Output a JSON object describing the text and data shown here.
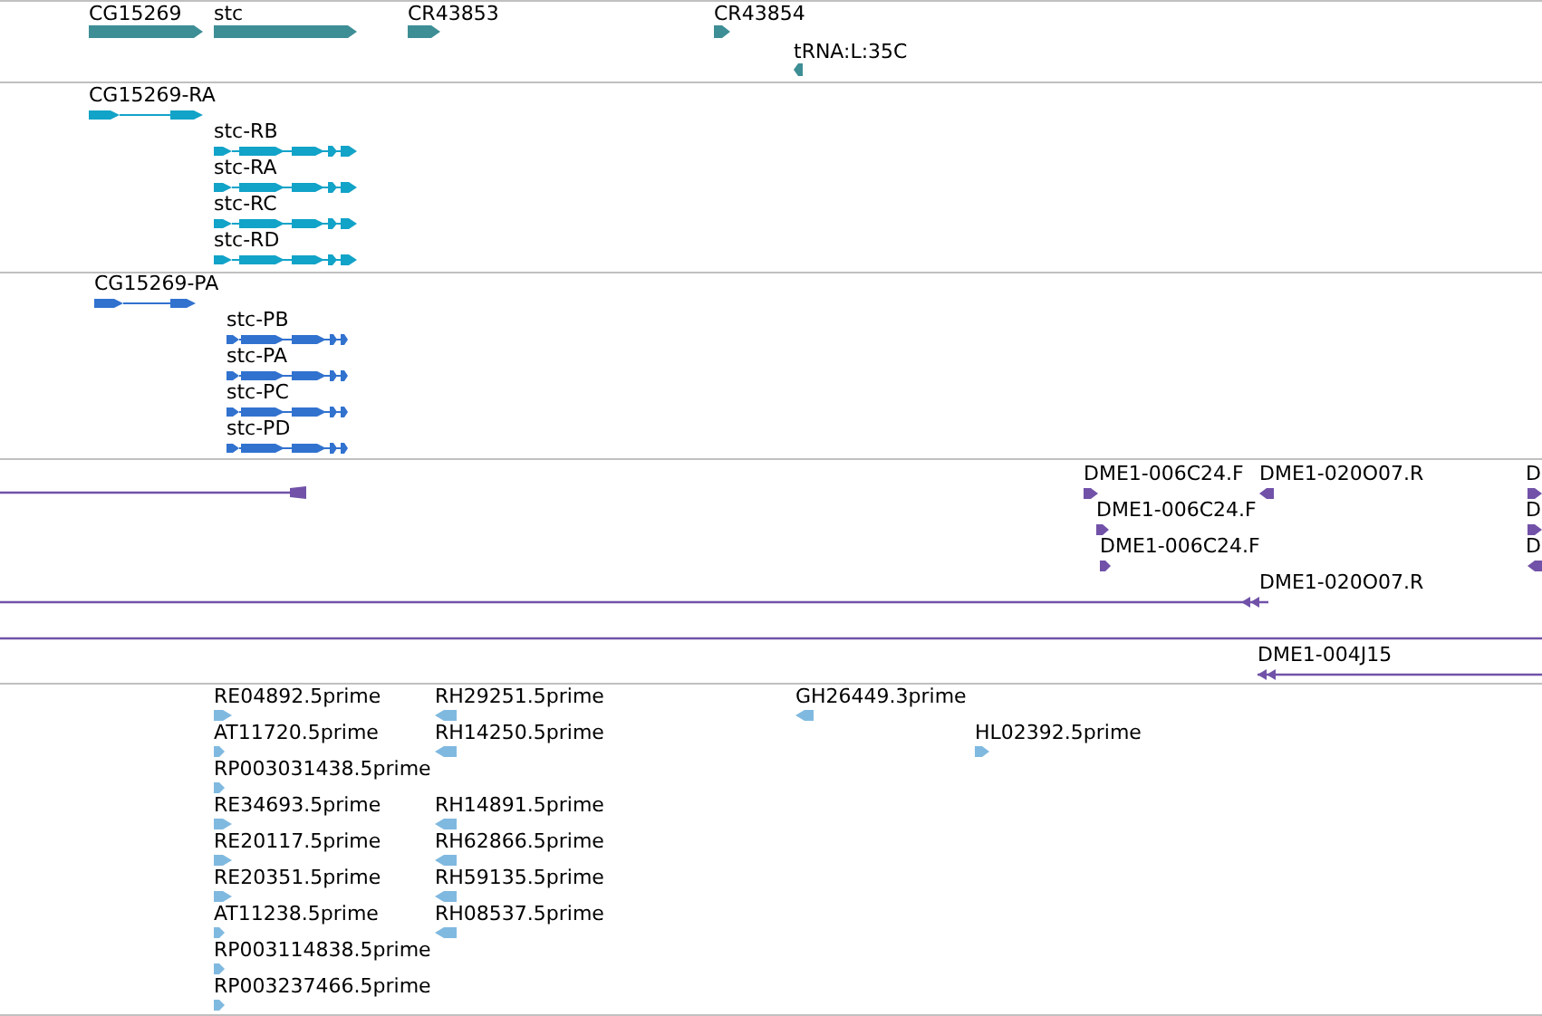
{
  "tracks": [
    {
      "kind": "gene",
      "color": "#3e8e96",
      "features": [
        {
          "label": "CG15269",
          "reverse": false
        },
        {
          "label": "stc",
          "reverse": false
        },
        {
          "label": "CR43853",
          "reverse": false
        },
        {
          "label": "CR43854",
          "reverse": false
        },
        {
          "label": "tRNA:L:35C",
          "reverse": true
        }
      ]
    },
    {
      "kind": "transcript",
      "color": "#12a3c8",
      "features": [
        {
          "label": "CG15269-RA",
          "reverse": false
        },
        {
          "label": "stc-RB",
          "reverse": false
        },
        {
          "label": "stc-RA",
          "reverse": false
        },
        {
          "label": "stc-RC",
          "reverse": false
        },
        {
          "label": "stc-RD",
          "reverse": false
        }
      ]
    },
    {
      "kind": "transcript",
      "color": "#3172cf",
      "features": [
        {
          "label": "CG15269-PA",
          "reverse": false
        },
        {
          "label": "stc-PB",
          "reverse": false
        },
        {
          "label": "stc-PA",
          "reverse": false
        },
        {
          "label": "stc-PC",
          "reverse": false
        },
        {
          "label": "stc-PD",
          "reverse": false
        }
      ]
    },
    {
      "kind": "clone",
      "color": "#7152a8",
      "features": [
        {
          "label": "DME1-006C24.F",
          "reverse": false
        },
        {
          "label": "DME1-020O07.R",
          "reverse": true
        },
        {
          "label": "D",
          "reverse": false
        },
        {
          "label": "DME1-006C24.F",
          "reverse": false
        },
        {
          "label": "D",
          "reverse": false
        },
        {
          "label": "DME1-006C24.F",
          "reverse": false
        },
        {
          "label": "D",
          "reverse": true
        },
        {
          "label": "DME1-020O07.R",
          "reverse": true
        },
        {
          "label": "DME1-004J15",
          "reverse": true
        }
      ]
    },
    {
      "kind": "est",
      "color": "#80b9e0",
      "features": [
        {
          "label": "RE04892.5prime",
          "reverse": false
        },
        {
          "label": "RH29251.5prime",
          "reverse": true
        },
        {
          "label": "GH26449.3prime",
          "reverse": true
        },
        {
          "label": "AT11720.5prime",
          "reverse": false
        },
        {
          "label": "RH14250.5prime",
          "reverse": true
        },
        {
          "label": "HL02392.5prime",
          "reverse": false
        },
        {
          "label": "RP003031438.5prime",
          "reverse": false
        },
        {
          "label": "RE34693.5prime",
          "reverse": false
        },
        {
          "label": "RH14891.5prime",
          "reverse": true
        },
        {
          "label": "RE20117.5prime",
          "reverse": false
        },
        {
          "label": "RH62866.5prime",
          "reverse": true
        },
        {
          "label": "RE20351.5prime",
          "reverse": false
        },
        {
          "label": "RH59135.5prime",
          "reverse": true
        },
        {
          "label": "AT11238.5prime",
          "reverse": false
        },
        {
          "label": "RH08537.5prime",
          "reverse": true
        },
        {
          "label": "RP003114838.5prime",
          "reverse": false
        },
        {
          "label": "RP003237466.5prime",
          "reverse": false
        }
      ]
    }
  ]
}
